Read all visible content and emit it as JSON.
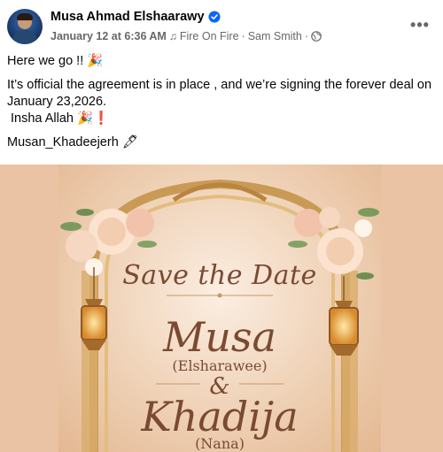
{
  "post": {
    "author_name": "Musa Ahmad Elshaarawy",
    "timestamp": "January 12 at 6:36 AM",
    "separator": "·",
    "song": "Fire On Fire",
    "artist": "Sam Smith",
    "audience_icon": "globe-icon",
    "more_label": "•••"
  },
  "text": {
    "line1": "Here we go !! 🎉",
    "line2": "It’s official the agreement is in place , and we’re signing the forever deal on January 23,2026.",
    "line3": "Insha Allah 🎉❗",
    "line4": "Musan_Khadeejerh 🖋"
  },
  "invitation": {
    "heading": "Save the Date",
    "name1": "Musa",
    "name1_sub": "(Elsharawee)",
    "ampersand": "&",
    "name2": "Khadija",
    "name2_sub": "(Nana)"
  },
  "colors": {
    "verified_blue": "#0866ff",
    "secondary_text": "#65676b",
    "invitation_text": "#7a4a32",
    "image_background": "#e9c3a4"
  }
}
